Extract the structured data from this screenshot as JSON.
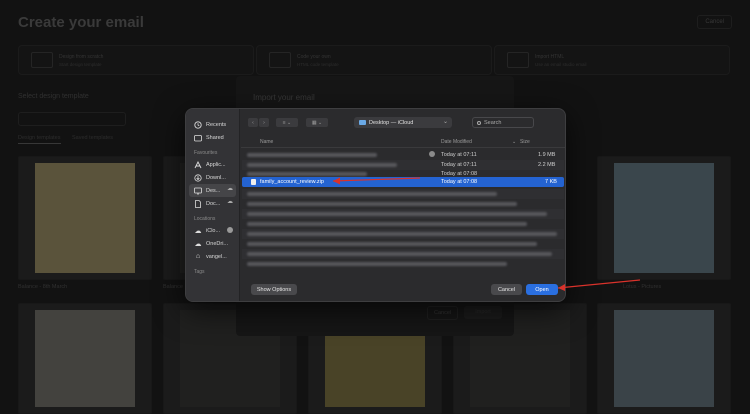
{
  "background": {
    "title": "Create your email",
    "cancel": "Cancel",
    "options": [
      {
        "title": "Design from scratch",
        "subtitle": "Start design template"
      },
      {
        "title": "Code your own",
        "subtitle": "HTML code template"
      },
      {
        "title": "Import HTML",
        "subtitle": "Use an email studio email"
      }
    ],
    "select_label": "Select design template",
    "tabs": [
      "Design templates",
      "Saved templates"
    ],
    "card_labels": [
      "Balance - 8th March",
      "Balance",
      "Lotus - Pictures"
    ],
    "card_colors": [
      "#e8d9a0",
      "#cfd8dc",
      "#cfd8dc",
      "#dfe6ea"
    ]
  },
  "import_panel": {
    "title": "Import your email",
    "cancel": "Cancel",
    "import": "Import"
  },
  "dialog": {
    "sidebar": {
      "items_top": [
        {
          "label": "Recents",
          "icon": "clock-icon"
        },
        {
          "label": "Shared",
          "icon": "shared-folder-icon"
        }
      ],
      "favourites_heading": "Favourites",
      "favourites": [
        {
          "label": "Applic...",
          "icon": "applications-icon"
        },
        {
          "label": "Downl...",
          "icon": "downloads-icon"
        },
        {
          "label": "Des...",
          "icon": "desktop-icon"
        },
        {
          "label": "Doc...",
          "icon": "document-icon"
        }
      ],
      "locations_heading": "Locations",
      "locations": [
        {
          "label": "iClo...",
          "icon": "cloud-icon"
        },
        {
          "label": "OneDri...",
          "icon": "cloud-icon"
        },
        {
          "label": "vangel...",
          "icon": "home-icon"
        }
      ],
      "tags_heading": "Tags"
    },
    "location": "Desktop — iCloud",
    "search_placeholder": "Search",
    "columns": {
      "name": "Name",
      "date": "Date Modified",
      "size": "Size"
    },
    "files": [
      {
        "name": "",
        "date": "Today at 07:11",
        "size": "1.9 MB"
      },
      {
        "name": "",
        "date": "Today at 07:11",
        "size": "2.2 MB"
      },
      {
        "name": "",
        "date": "Today at 07:08",
        "size": ""
      },
      {
        "name": "family_account_review.zip",
        "date": "Today at 07:08",
        "size": "7 KB"
      }
    ],
    "show_options": "Show Options",
    "cancel": "Cancel",
    "open": "Open"
  },
  "colors": {
    "accent": "#2a6fe0",
    "selection": "#2463d1",
    "annotation": "#d9322b"
  }
}
